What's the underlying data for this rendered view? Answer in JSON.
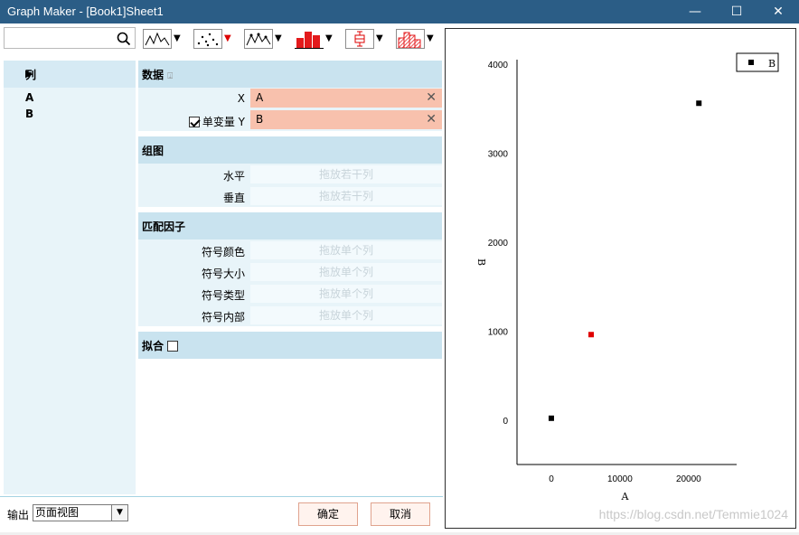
{
  "window": {
    "title": "Graph Maker - [Book1]Sheet1",
    "controls": {
      "minimize": "—",
      "maximize": "☐",
      "close": "✕"
    }
  },
  "toolbar": {
    "search_placeholder": "",
    "tools": [
      {
        "name": "line-graph-icon"
      },
      {
        "name": "scatter-graph-icon"
      },
      {
        "name": "line-symbol-graph-icon"
      },
      {
        "name": "column-graph-icon"
      },
      {
        "name": "box-chart-icon"
      },
      {
        "name": "histogram-icon"
      }
    ]
  },
  "columns": {
    "header": "列",
    "items": [
      "A",
      "B"
    ]
  },
  "data_section": {
    "title": "数据",
    "x_label": "X",
    "x_value": "A",
    "y_checkbox_label": "单变量",
    "y_label": "Y",
    "y_value": "B",
    "y_checked": true
  },
  "group_section": {
    "title": "组图",
    "rows": [
      {
        "label": "水平",
        "placeholder": "拖放若干列"
      },
      {
        "label": "垂直",
        "placeholder": "拖放若干列"
      }
    ]
  },
  "factor_section": {
    "title": "匹配因子",
    "rows": [
      {
        "label": "符号颜色",
        "placeholder": "拖放单个列"
      },
      {
        "label": "符号大小",
        "placeholder": "拖放单个列"
      },
      {
        "label": "符号类型",
        "placeholder": "拖放单个列"
      },
      {
        "label": "符号内部",
        "placeholder": "拖放单个列"
      }
    ]
  },
  "fit_section": {
    "title": "拟合",
    "checked": false
  },
  "footer": {
    "output_label": "输出",
    "output_value": "页面视图",
    "ok_label": "确定",
    "cancel_label": "取消"
  },
  "watermark": "https://blog.csdn.net/Temmie1024",
  "chart_data": {
    "type": "scatter",
    "xlabel": "A",
    "ylabel": "B",
    "xticks": [
      "0",
      "10000",
      "20000"
    ],
    "yticks": [
      "0",
      "1000",
      "2000",
      "3000",
      "4000"
    ],
    "xlim": [
      -5000,
      27000
    ],
    "ylim": [
      -500,
      4050
    ],
    "series": [
      {
        "name": "B",
        "points": [
          {
            "x": 0,
            "y": 20,
            "color": "#000000"
          },
          {
            "x": 5800,
            "y": 960,
            "color": "#e00000"
          },
          {
            "x": 21500,
            "y": 3560,
            "color": "#000000"
          }
        ]
      }
    ],
    "legend": {
      "position": "top-right"
    }
  }
}
